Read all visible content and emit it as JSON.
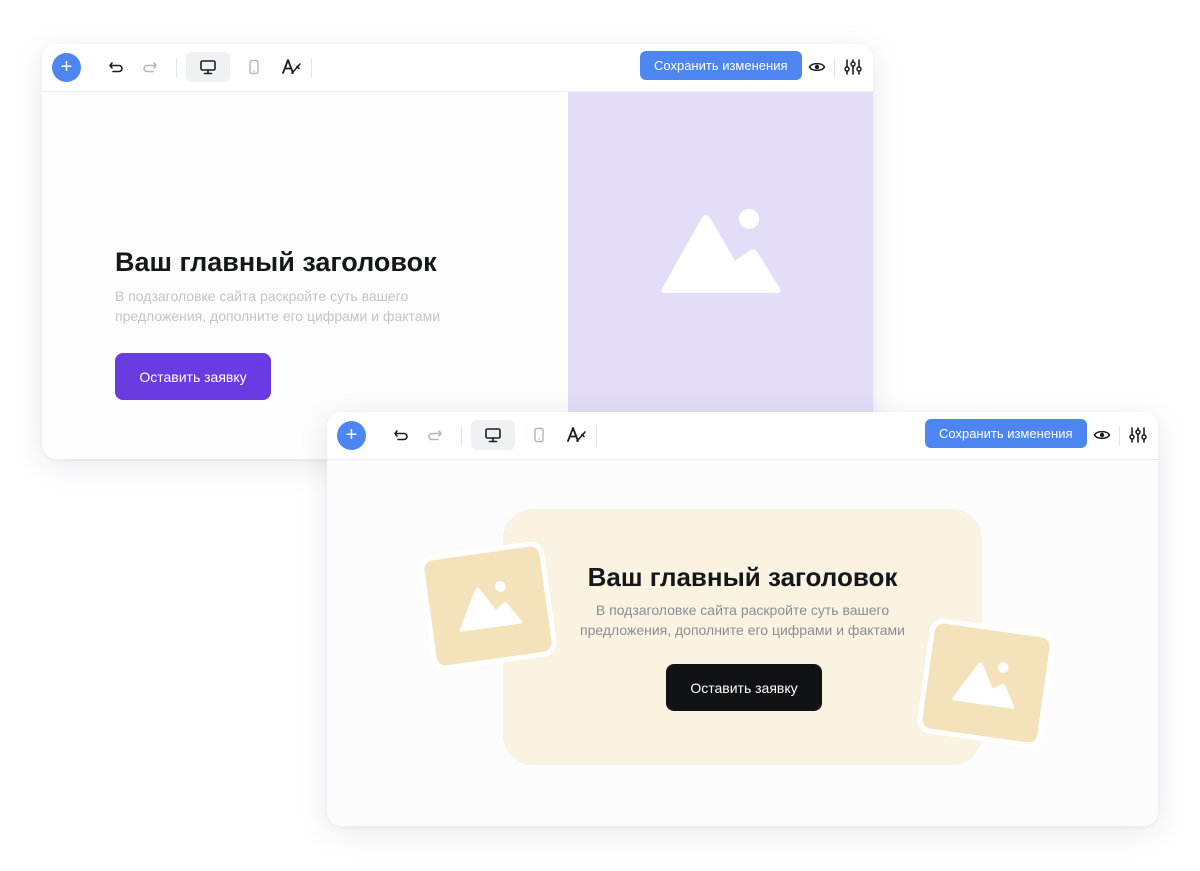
{
  "editor_top": {
    "toolbar": {
      "add_label": "+",
      "save_label": "Сохранить изменения"
    },
    "hero": {
      "title": "Ваш главный заголовок",
      "subtitle": "В подзаголовке сайта раскройте суть вашего предложения, дополните его цифрами и фактами",
      "cta_label": "Оставить заявку",
      "image_color": "#e3ddf8",
      "cta_color": "#6a3be0"
    }
  },
  "editor_bottom": {
    "toolbar": {
      "add_label": "+",
      "save_label": "Сохранить изменения"
    },
    "hero": {
      "title": "Ваш главный заголовок",
      "subtitle": "В подзаголовке сайта раскройте суть вашего предложения, дополните его цифрами и фактами",
      "cta_label": "Оставить заявку",
      "card_color": "#faf3e2",
      "cta_color": "#111214"
    }
  },
  "colors": {
    "accent": "#4d86f0"
  },
  "icons": [
    "add-icon",
    "undo-icon",
    "redo-icon",
    "desktop-icon",
    "mobile-icon",
    "typography-icon",
    "eye-icon",
    "settings-sliders-icon",
    "image-placeholder-icon"
  ]
}
